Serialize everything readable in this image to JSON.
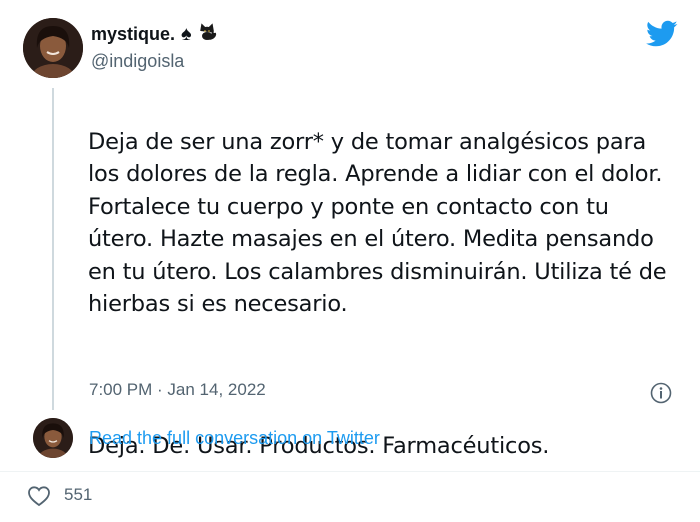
{
  "author": {
    "display_name": "mystique.",
    "emoji": "♠",
    "emoji2": "🐈‍⬛",
    "handle": "@indigoisla",
    "avatar_icon": "profile-photo"
  },
  "tweet": {
    "paragraph1": "Deja de ser una zorr* y de tomar analgésicos para los dolores de la regla. Aprende a lidiar con el dolor. Fortalece tu cuerpo y ponte en contacto con tu útero. Hazte masajes en el útero. Medita pensando en tu útero. Los calambres disminuirán. Utiliza té de hierbas si es necesario.",
    "paragraph2": "Deja. De. Usar. Productos. Farmacéuticos.",
    "timestamp": "7:00 PM · Jan 14, 2022"
  },
  "footer": {
    "read_link": "Read the full conversation on Twitter",
    "like_count": "551"
  },
  "colors": {
    "twitter_blue": "#1d9bf0",
    "secondary_text": "#536471",
    "primary_text": "#0f1419"
  }
}
